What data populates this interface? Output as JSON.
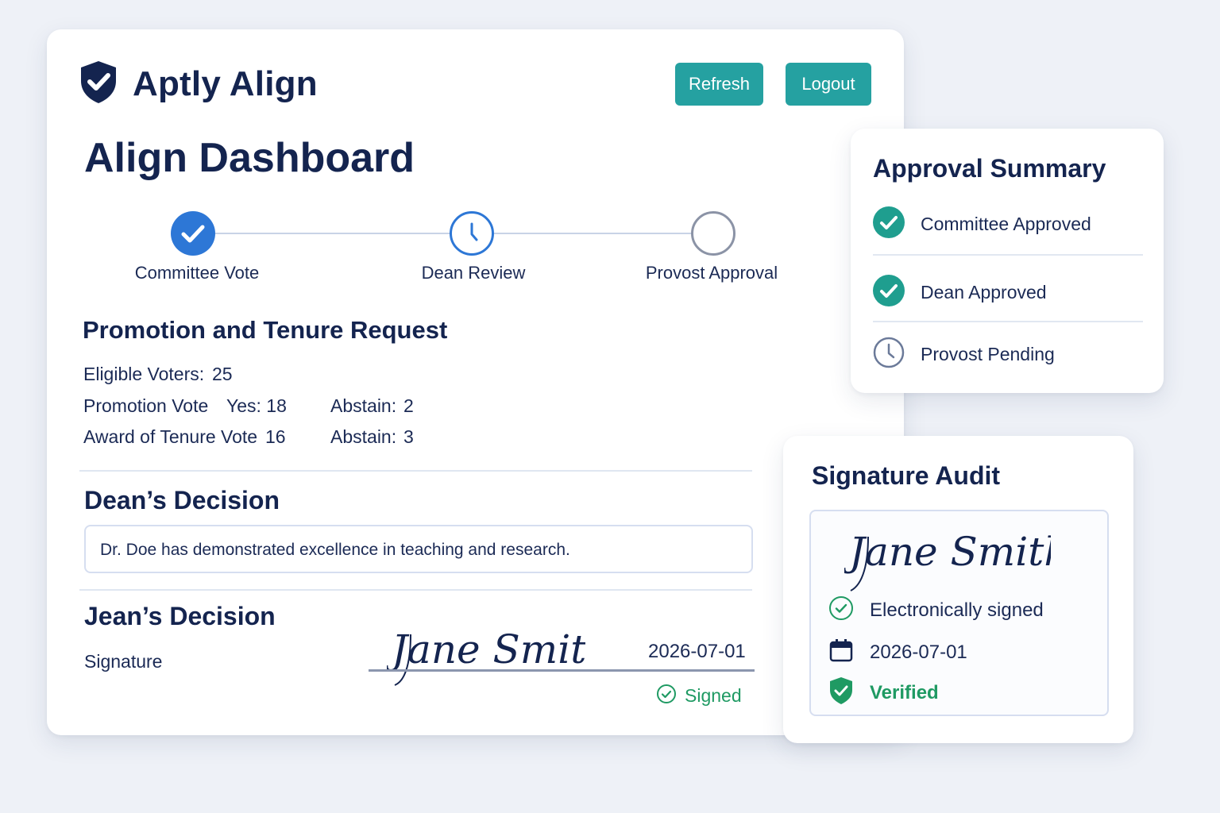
{
  "app": {
    "name": "Aptly Align",
    "logo_icon": "shield-check-icon"
  },
  "header": {
    "refresh_label": "Refresh",
    "logout_label": "Logout"
  },
  "page": {
    "title": "Align Dashboard"
  },
  "stepper": {
    "steps": [
      {
        "label": "Committee Vote",
        "state": "complete",
        "icon": "check-icon"
      },
      {
        "label": "Dean Review",
        "state": "in-progress",
        "icon": "clock-icon"
      },
      {
        "label": "Provost Approval",
        "state": "pending",
        "icon": "empty-circle-icon"
      }
    ]
  },
  "request": {
    "title": "Promotion and Tenure Request",
    "eligible_label": "Eligible Voters:",
    "eligible_value": "25",
    "promotion_label": "Promotion Vote",
    "promotion_yes": "Yes: 18",
    "promotion_abstain_label": "Abstain:",
    "promotion_abstain_value": "2",
    "tenure_label": "Award of Tenure Vote",
    "tenure_value": "16",
    "tenure_abstain_label": "Abstain:",
    "tenure_abstain_value": "3"
  },
  "dean_decision": {
    "title": "Dean’s Decision",
    "comment": "Dr. Doe has demonstrated excellence in teaching and research."
  },
  "jean_decision": {
    "title": "Jean’s Decision",
    "signature_label": "Signature",
    "signature_name": "Jane Smith",
    "date": "2026-07-01",
    "status": "Signed"
  },
  "approval_summary": {
    "title": "Approval Summary",
    "items": [
      {
        "label": "Committee Approved",
        "icon": "check-circle-icon"
      },
      {
        "label": "Dean Approved",
        "icon": "check-circle-icon"
      },
      {
        "label": "Provost Pending",
        "icon": "clock-icon"
      }
    ]
  },
  "signature_audit": {
    "title": "Signature Audit",
    "signature_name": "Jane Smith",
    "signed_label": "Electronically signed",
    "date": "2026-07-01",
    "verified_label": "Verified"
  },
  "colors": {
    "navy": "#14244f",
    "teal": "#25a1a1",
    "blue": "#2d77d6",
    "green": "#1f9a63",
    "background": "#eef1f7"
  }
}
